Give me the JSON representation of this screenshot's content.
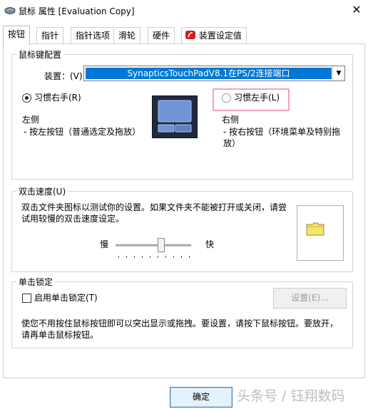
{
  "window": {
    "title": "鼠标 属性 [Evaluation Copy]",
    "close_glyph": "✕",
    "app_icon": "mouse-icon"
  },
  "tabs": [
    {
      "label": "按钮",
      "active": true
    },
    {
      "label": "指针",
      "active": false
    },
    {
      "label": "指针选项",
      "active": false
    },
    {
      "label": "滑轮",
      "active": false
    },
    {
      "label": "硬件",
      "active": false
    },
    {
      "label": "装置设定值",
      "active": false,
      "icon": "synaptics-icon"
    }
  ],
  "mouse_config": {
    "legend": "鼠标键配置",
    "device_label": "装置：(V)",
    "device_value": "SynapticsTouchPadV8.1在PS/2连接端口",
    "right_hand_label": "习惯右手(R)",
    "left_hand_label": "习惯左手(L)",
    "right_hand_selected": true,
    "left_title": "左侧",
    "left_desc": "- 按左按钮（普通选定及拖放）",
    "right_title": "右侧",
    "right_desc_1": "- 按右按钮（环境菜单及特别拖",
    "right_desc_2": "放）"
  },
  "double_click": {
    "legend": "双击速度(U)",
    "desc_1": "双击文件夹图标以测试你的设置。如果文件夹不能被打开或关闭，请尝",
    "desc_2": "试用较慢的双击速度设定。",
    "slow_label": "慢",
    "fast_label": "快",
    "slider_position": 0.6,
    "test_icon": "folder-icon"
  },
  "click_lock": {
    "legend": "单击锁定",
    "checkbox_label": "启用单击锁定(T)",
    "checked": false,
    "settings_button": "设置(E)...",
    "desc_1": "使您不用按住鼠标按钮即可以突出显示或拖拽。要设置，请按下鼠标按钮。要放开，",
    "desc_2": "请再单击鼠标按钮。"
  },
  "footer": {
    "ok_label": "确定",
    "watermark": "头条号 / 钰翔数码"
  },
  "colors": {
    "selection": "#0078d7",
    "highlight_border": "#f2a0c4",
    "folder": "#f5e36b"
  }
}
